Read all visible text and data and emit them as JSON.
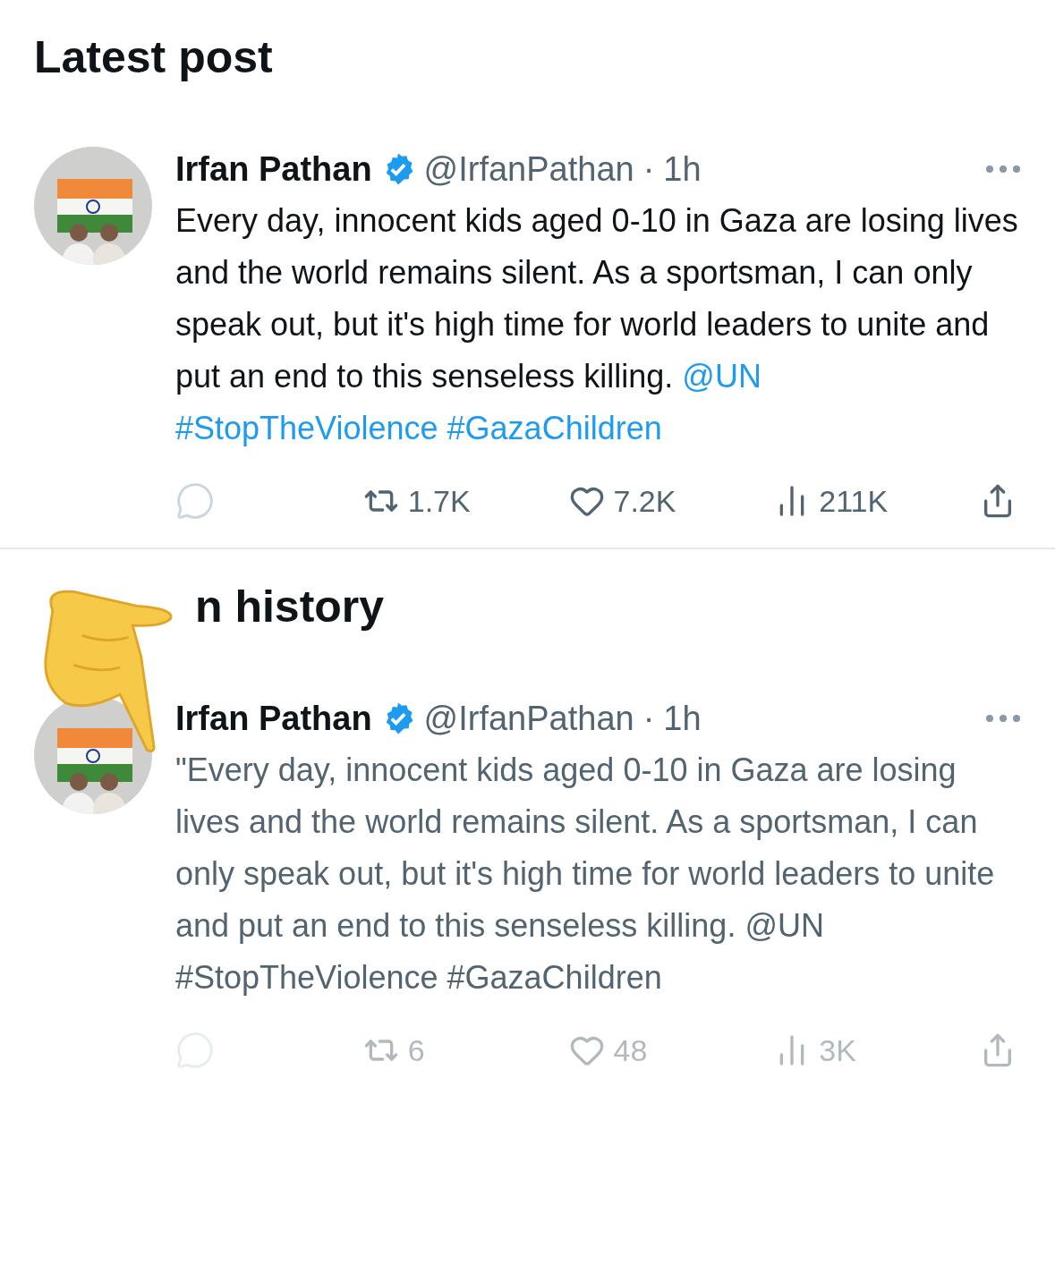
{
  "sections": [
    {
      "heading": "Latest post",
      "pointer_overlay": false,
      "tweet": {
        "name": "Irfan Pathan",
        "verified": true,
        "handle": "@IrfanPathan",
        "dot": "·",
        "time": "1h",
        "historical": false,
        "body": [
          {
            "kind": "text",
            "text": "Every day, innocent kids aged 0-10 in Gaza are losing lives and the world remains silent. As a sportsman, I can only speak out, but it's high time for world leaders to unite and put an end to this senseless killing."
          },
          {
            "kind": "link",
            "text": "@UN"
          },
          {
            "kind": "link",
            "text": "#StopTheViolence"
          },
          {
            "kind": "link",
            "text": "#GazaChildren"
          }
        ],
        "actions": [
          {
            "kind": "reply"
          },
          {
            "kind": "repost",
            "count": "1.7K"
          },
          {
            "kind": "like",
            "count": "7.2K"
          },
          {
            "kind": "views",
            "count": "211K"
          },
          {
            "kind": "share"
          }
        ]
      }
    },
    {
      "heading": "n history",
      "pointer_overlay": true,
      "tweet": {
        "name": "Irfan Pathan",
        "verified": true,
        "handle": "@IrfanPathan",
        "dot": "·",
        "time": "1h",
        "historical": true,
        "body": [
          {
            "kind": "text",
            "text": "\"Every day, innocent kids aged 0-10 in Gaza are losing lives and the world remains silent. As a sportsman, I can only speak out, but it's high time for world leaders to unite and put an end to this senseless killing. @UN #StopTheViolence #GazaChildren"
          }
        ],
        "actions": [
          {
            "kind": "reply"
          },
          {
            "kind": "repost",
            "count": "6"
          },
          {
            "kind": "like",
            "count": "48"
          },
          {
            "kind": "views",
            "count": "3K"
          },
          {
            "kind": "share"
          }
        ]
      }
    }
  ]
}
